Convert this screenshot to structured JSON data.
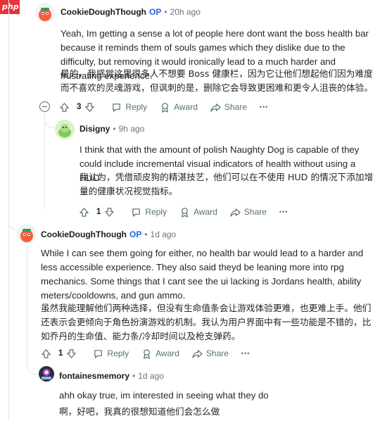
{
  "watermark": "php",
  "comments": [
    {
      "author": "CookieDoughThough",
      "op": "OP",
      "time": "20h ago",
      "text_en": "Yeah, Im getting a sense a lot of people here dont want the boss health bar because it reminds them of souls games which they dislike due to the difficulty, but removing it would ironically lead to a much harder and frustrating experience.",
      "text_cn": "是的，我感觉这里很多人不想要 Boss 健康栏，因为它让他们想起他们因为难度而不喜欢的灵魂游戏，但讽刺的是，删除它会导致更困难和更令人沮丧的体验。",
      "votes": "3"
    },
    {
      "author": "Disigny",
      "time": "9h ago",
      "text_en": "I think that with the amount of polish Naughty Dog is capable of they could include incremental visual indicators of health without using a HUD.",
      "text_cn": "我认为，凭借顽皮狗的精湛技艺，他们可以在不使用 HUD 的情况下添加增量的健康状况视觉指标。",
      "votes": "1"
    },
    {
      "author": "CookieDoughThough",
      "op": "OP",
      "time": "1d ago",
      "text_en": "While I can see them going for either, no health bar would lead to a harder and less accessible experience. They also said theyd be leaning more into rpg mechanics. Some things that I cant see the ui lacking is Jordans health, ability meters/cooldowns, and gun ammo.",
      "text_cn": "虽然我能理解他们两种选择，但没有生命值条会让游戏体验更难，也更难上手。他们还表示会更倾向于角色扮演游戏的机制。我认为用户界面中有一些功能是不错的，比如乔丹的生命值、能力条/冷却时间以及枪支弹药。",
      "votes": "1"
    },
    {
      "author": "fontainesmemory",
      "time": "1d ago",
      "text_en": "ahh okay true, im interested in seeing what they do",
      "text_cn": "啊，好吧，我真的很想知道他们会怎么做"
    }
  ],
  "actions": {
    "reply": "Reply",
    "award": "Award",
    "share": "Share",
    "more": "•••"
  }
}
